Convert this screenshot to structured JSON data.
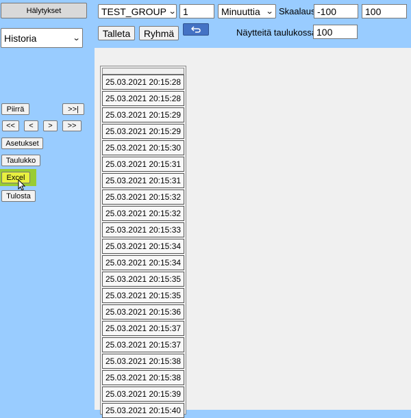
{
  "sidebar": {
    "alarms_button": "Hälytykset",
    "view_select": "Historia",
    "draw_button": "Piirrä",
    "nav": {
      "to_end": ">>|",
      "first": "<<",
      "prev": "<",
      "next": ">",
      "last": ">>"
    },
    "settings_button": "Asetukset",
    "table_button": "Taulukko",
    "excel_button": "Excel",
    "print_button": "Tulosta"
  },
  "toolbar": {
    "group_select": "TEST_GROUP",
    "period_value": "1",
    "unit_select": "Minuuttia",
    "scale_label": "Skaalaus",
    "scale_min": "-100",
    "scale_max": "100",
    "save_button": "Talleta",
    "group_button": "Ryhmä",
    "back_icon": "undo-arrow-icon",
    "rows_label": "Näytteitä taulukossa",
    "rows_value": "100"
  },
  "table": {
    "rows": [
      "25.03.2021 20:15:28",
      "25.03.2021 20:15:28",
      "25.03.2021 20:15:29",
      "25.03.2021 20:15:29",
      "25.03.2021 20:15:30",
      "25.03.2021 20:15:31",
      "25.03.2021 20:15:31",
      "25.03.2021 20:15:32",
      "25.03.2021 20:15:32",
      "25.03.2021 20:15:33",
      "25.03.2021 20:15:34",
      "25.03.2021 20:15:34",
      "25.03.2021 20:15:35",
      "25.03.2021 20:15:35",
      "25.03.2021 20:15:36",
      "25.03.2021 20:15:37",
      "25.03.2021 20:15:37",
      "25.03.2021 20:15:38",
      "25.03.2021 20:15:38",
      "25.03.2021 20:15:39",
      "25.03.2021 20:15:40"
    ]
  },
  "colors": {
    "background": "#99ccff",
    "excel_highlight": "#99cc33",
    "excel_button": "#e8f040",
    "back_button": "#4472c4"
  }
}
